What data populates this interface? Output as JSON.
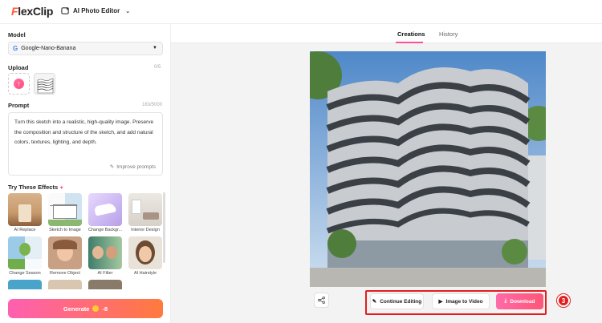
{
  "header": {
    "logo": "FlexClip",
    "tool": "AI Photo Editor"
  },
  "sidebar": {
    "model_label": "Model",
    "model_value": "Google-Nano-Banana",
    "upload_label": "Upload",
    "upload_count": "0/5",
    "prompt_label": "Prompt",
    "prompt_count": "163/5000",
    "prompt_text": "Turn this sketch into a realistic, high-quality image. Preserve the composition and structure of the sketch, and add natural colors, textures, lighting, and depth.",
    "improve_label": "Improve prompts",
    "effects_label": "Try These Effects",
    "effects": [
      {
        "label": "AI Replace"
      },
      {
        "label": "Sketch to Image"
      },
      {
        "label": "Change Backgr..."
      },
      {
        "label": "Interior Design"
      },
      {
        "label": "Change Season"
      },
      {
        "label": "Remove Object"
      },
      {
        "label": "AI Filter"
      },
      {
        "label": "AI Hairstyle"
      }
    ],
    "generate_label": "Generate",
    "generate_cost": "-8"
  },
  "main": {
    "tabs": [
      {
        "label": "Creations",
        "active": true
      },
      {
        "label": "History",
        "active": false
      }
    ],
    "actions": {
      "continue": "Continue Editing",
      "video": "Image to Video",
      "download": "Download"
    },
    "step_badge": "3"
  },
  "colors": {
    "accent": "#ff4f9a",
    "highlight": "#e02020"
  }
}
